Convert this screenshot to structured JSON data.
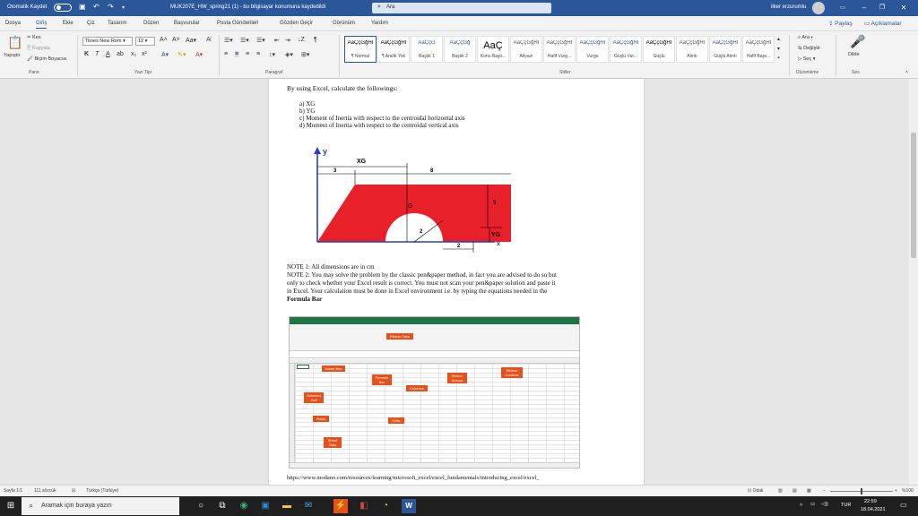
{
  "titlebar": {
    "autosave_label": "Otomatik Kaydet",
    "doc_title": "MUK207E_HW_spring21 (1)  -  bu bilgisayar konumuna kaydedildi",
    "search_placeholder": "Ara",
    "user_name": "ilker erzurumlu"
  },
  "menu": {
    "items": [
      "Dosya",
      "Giriş",
      "Ekle",
      "Çiz",
      "Tasarım",
      "Düzen",
      "Başvurular",
      "Posta Gönderileri",
      "Gözden Geçir",
      "Görünüm",
      "Yardım"
    ],
    "active": "Giriş",
    "share_label": "Paylaş",
    "comments_label": "Açıklamalar"
  },
  "ribbon": {
    "paste_label": "Yapıştır",
    "cut_label": "Kes",
    "copy_label": "Kopyala",
    "format_painter_label": "Biçim Boyacısı",
    "font_name": "Times New Rom",
    "font_size": "12",
    "styles": [
      {
        "sample": "AaÇçĞğHİ",
        "name": "¶ Normal"
      },
      {
        "sample": "AaÇçĞğHİ",
        "name": "¶ Aralık Yok"
      },
      {
        "sample": "AaÇçĞ",
        "name": "Başlık 1"
      },
      {
        "sample": "AaÇçĞğ",
        "name": "Başlık 2"
      },
      {
        "sample": "AaÇ",
        "name": "Konu Başlı..."
      },
      {
        "sample": "AaÇçĞğHİ",
        "name": "Altyazı"
      },
      {
        "sample": "AaÇçĞğHİ",
        "name": "Hafif Vurg..."
      },
      {
        "sample": "AaÇçĞğHİ",
        "name": "Vurgu"
      },
      {
        "sample": "AaÇçĞğHİ",
        "name": "Güçlü Vur..."
      },
      {
        "sample": "AaÇçĞğHİ",
        "name": "Güçlü"
      },
      {
        "sample": "AaÇçĞğHİ",
        "name": "Alıntı"
      },
      {
        "sample": "AaÇçĞğHİ",
        "name": "Güçlü Alıntı"
      },
      {
        "sample": "AaÇçĞğHİ",
        "name": "Hafif Başv..."
      }
    ],
    "find_label": "Ara",
    "replace_label": "Değiştir",
    "select_label": "Seç",
    "dictate_label": "Dikte",
    "groups": {
      "clipboard": "Pano",
      "font": "Yazı Tipi",
      "paragraph": "Paragraf",
      "styles": "Stiller",
      "editing": "Düzenleme",
      "voice": "Ses"
    }
  },
  "document": {
    "intro": "By using Excel, calculate the followings:",
    "items": [
      "a)  XG",
      "b)  YG",
      "c)  Moment of Inertia with respect to the centroidal horizontal axis",
      "d)  Moment of Inertia with respect to the centroidal vertical axis"
    ],
    "figure": {
      "dim_xg": "XG",
      "dim_3": "3",
      "dim_8": "8",
      "dim_5": "5",
      "dim_2a": "2",
      "dim_2b": "2",
      "label_g": "G",
      "label_yg": "YG",
      "axis_y": "y",
      "axis_x": "x"
    },
    "note1": "NOTE 1: All dimensions are in cm",
    "note2_lines": [
      "NOTE 2: You may solve the problem by the classic pen&paper method, in fact you are advised to do so but",
      "only to check whether your Excel result is correct. You must not scan your pen&paper solution and paste it",
      "in Excel. Your calculation must be done in Excel environment i.e. by typing the equations needed in the"
    ],
    "formula_bar": "Formula Bar",
    "excel_callouts": [
      "Ribbon Tabs",
      "Name Box",
      "Formula Bar",
      "Columns",
      "Ribbon Groups",
      "Ribbon Controls",
      "Selected Cell",
      "Rows",
      "Cells",
      "Sheet Tabs"
    ],
    "url": "https://www.modano.com/resources/learning/microsoft_excel/excel_fundamentals/introducing_excel/excel_"
  },
  "statusbar": {
    "page": "Sayfa 1/1",
    "words": "111 sözcük",
    "language": "Türkçe (Türkiye)",
    "focus": "Odak",
    "zoom": "%100"
  },
  "taskbar": {
    "search_placeholder": "Aramak için buraya yazın",
    "lang": "TUR",
    "time": "22:59",
    "date": "18.04.2021"
  },
  "colors": {
    "accent": "#2b579a",
    "shape_fill": "#e8202a",
    "axis": "#2b3fc1"
  }
}
